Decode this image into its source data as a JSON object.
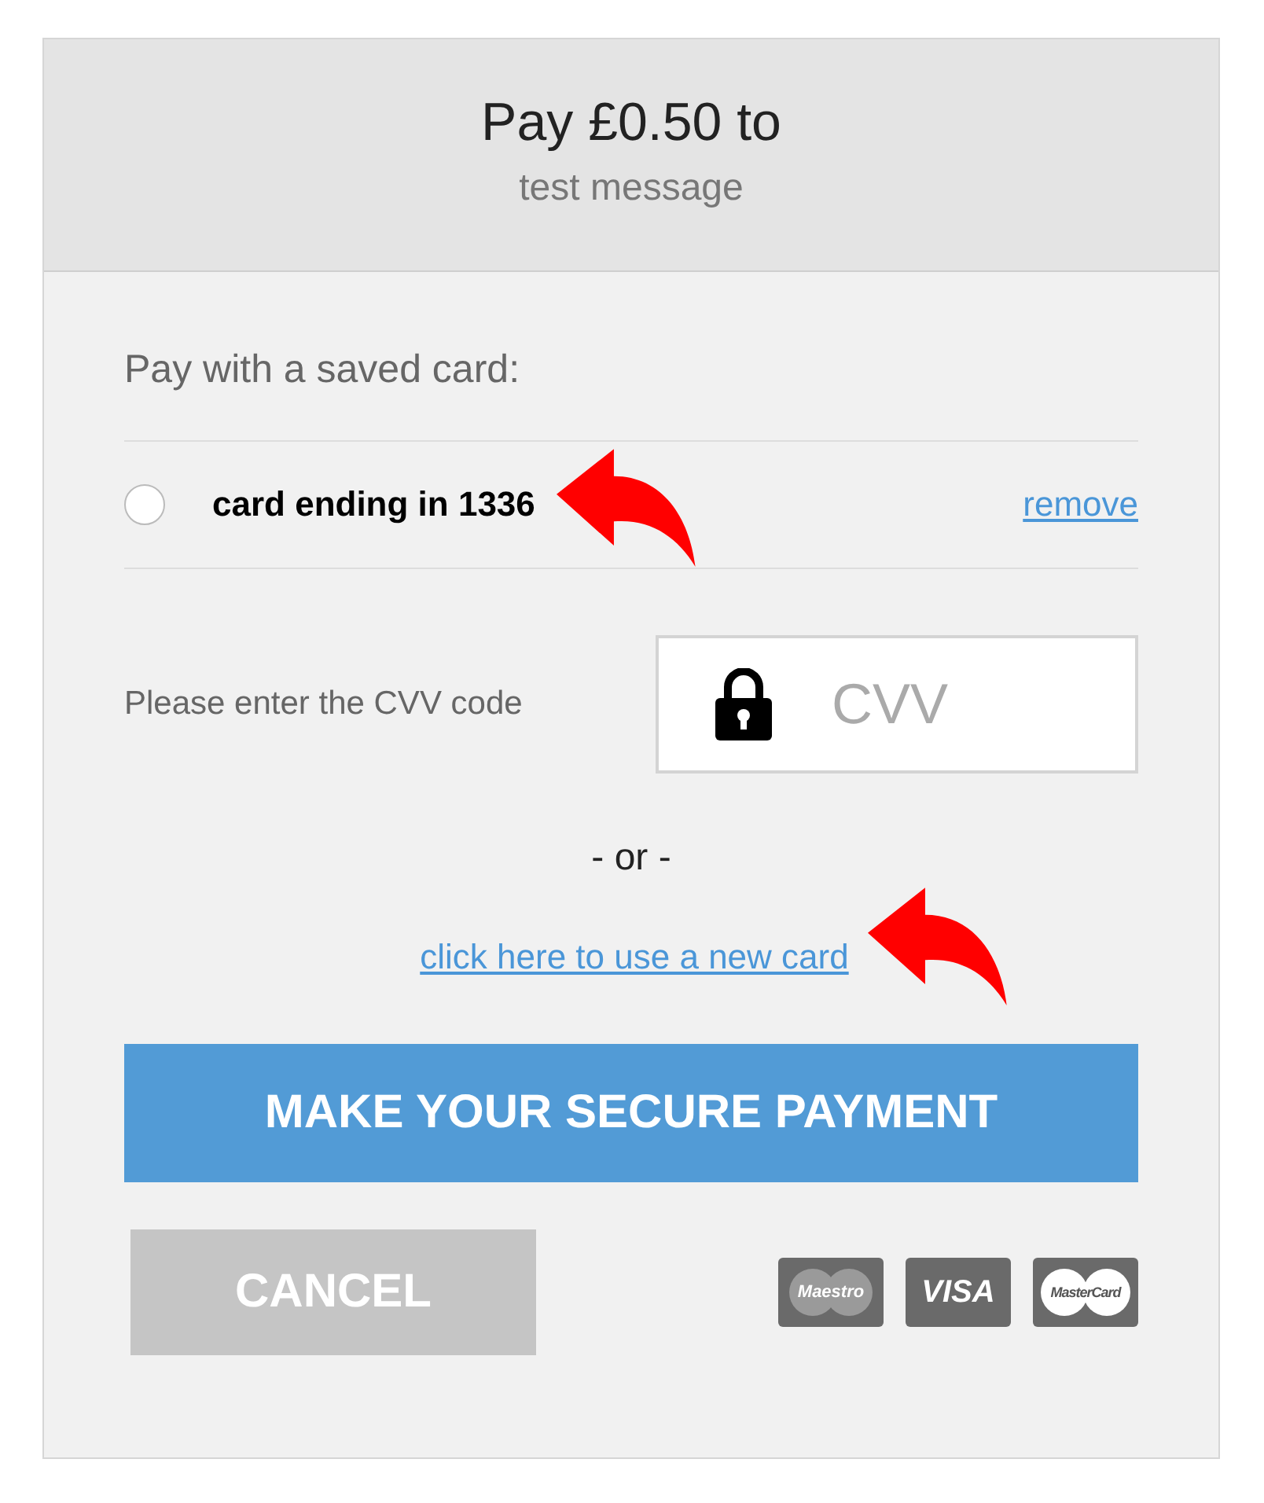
{
  "header": {
    "title": "Pay £0.50 to",
    "subtitle": "test message"
  },
  "saved_cards": {
    "heading": "Pay with a saved card:",
    "cards": [
      {
        "label": "card ending in 1336",
        "selected": false,
        "remove_link": "remove"
      }
    ]
  },
  "cvv": {
    "label": "Please enter the CVV code",
    "placeholder": "CVV"
  },
  "separator": "- or -",
  "new_card_link": "click here to use a new card",
  "pay_button": "MAKE YOUR SECURE PAYMENT",
  "cancel_button": "CANCEL",
  "card_logos": [
    {
      "kind": "maestro",
      "label": "Maestro"
    },
    {
      "kind": "visa",
      "label": "VISA"
    },
    {
      "kind": "mastercard",
      "label": "MasterCard"
    }
  ]
}
